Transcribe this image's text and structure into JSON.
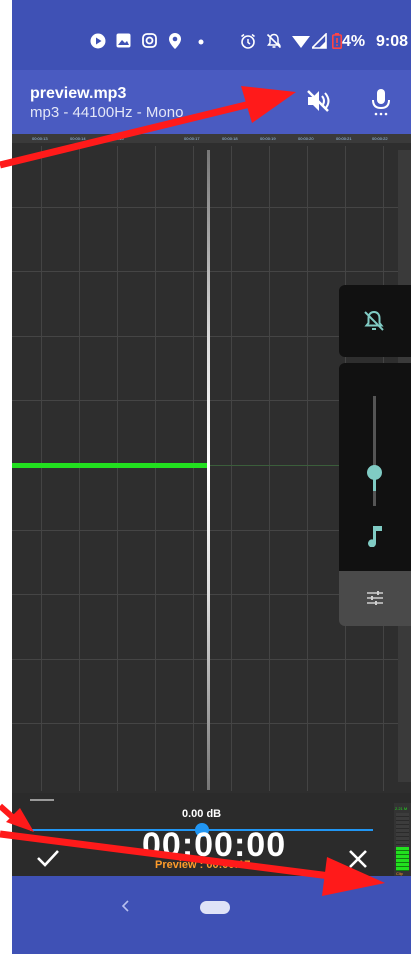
{
  "status_bar": {
    "battery_percent": "4%",
    "time": "9:08",
    "icons": [
      "play-icon",
      "image-icon",
      "instagram-icon",
      "location-icon",
      "dot-icon",
      "alarm-icon",
      "notifications-off-icon",
      "wifi-icon",
      "signal-icon",
      "battery-low-icon"
    ]
  },
  "app_bar": {
    "file_name": "preview.mp3",
    "file_info": "mp3 - 44100Hz - Mono",
    "mute_button_icon": "volume-off-icon",
    "record_button_icon": "microphone-icon"
  },
  "timeline": {
    "ticks": [
      "00:00:13",
      "00:00:14",
      "00:00:15",
      "00:00:17",
      "00:00:18",
      "00:00:19",
      "00:00:20",
      "00:00:21",
      "00:00:22"
    ]
  },
  "side_panel": {
    "mute_icon": "notifications-off-icon",
    "volume_level": 0.35,
    "music_icon": "music-note-icon",
    "eq_icon": "sliders-icon"
  },
  "bottom": {
    "gain_label": "0.00 dB",
    "gain_position": 0.5,
    "timer": "00:00:00",
    "preview_label": "Preview : 00:00:17",
    "confirm_icon": "check-icon",
    "cancel_icon": "close-icon"
  },
  "level_meter": {
    "top_label": "2.21 M",
    "bottom_label": "Clip",
    "level": 0.35
  },
  "nav": {
    "back_icon": "back-icon",
    "home_icon": "home-pill-icon"
  },
  "colors": {
    "status_bar": "#3f51b5",
    "waveform": "#22e01f",
    "accent": "#80cbc4",
    "slider": "#2196f3",
    "preview": "#ff9c2a",
    "annotation_arrow": "#ff1a1a"
  }
}
